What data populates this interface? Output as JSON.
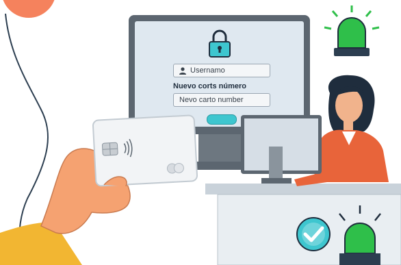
{
  "login_form": {
    "username_placeholder": "Usernamo",
    "card_label": "Nuevo corts número",
    "card_placeholder": "Nevo carto number"
  },
  "icons": {
    "lock": "lock-icon",
    "user": "user-icon",
    "check": "check-icon",
    "alert_lights": "siren-light-icon",
    "contactless": "contactless-icon"
  },
  "colors": {
    "monitor_frame": "#5c6670",
    "screen": "#dfe8f0",
    "accent_teal": "#3ec6cf",
    "siren_green": "#2fbf4a",
    "sleeve_yellow": "#f2b632",
    "jacket_orange": "#e8643a"
  }
}
